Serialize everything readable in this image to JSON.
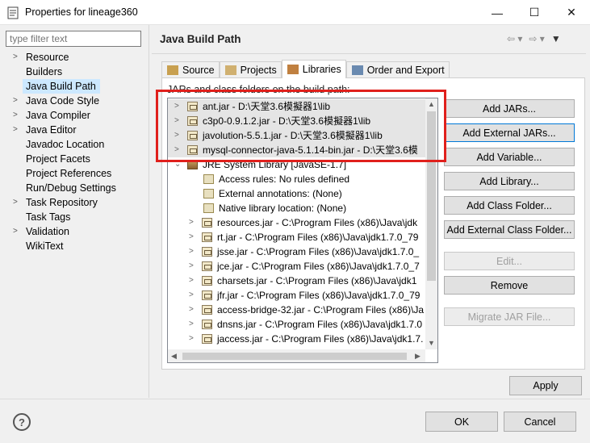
{
  "window": {
    "title": "Properties for lineage360",
    "minimize": "—",
    "maximize": "☐",
    "close": "✕"
  },
  "filter": {
    "placeholder": "type filter text"
  },
  "nav": [
    {
      "label": "Resource",
      "expandable": true
    },
    {
      "label": "Builders",
      "expandable": false
    },
    {
      "label": "Java Build Path",
      "expandable": false,
      "selected": true
    },
    {
      "label": "Java Code Style",
      "expandable": true
    },
    {
      "label": "Java Compiler",
      "expandable": true
    },
    {
      "label": "Java Editor",
      "expandable": true
    },
    {
      "label": "Javadoc Location",
      "expandable": false
    },
    {
      "label": "Project Facets",
      "expandable": false
    },
    {
      "label": "Project References",
      "expandable": false
    },
    {
      "label": "Run/Debug Settings",
      "expandable": false
    },
    {
      "label": "Task Repository",
      "expandable": true
    },
    {
      "label": "Task Tags",
      "expandable": false
    },
    {
      "label": "Validation",
      "expandable": true
    },
    {
      "label": "WikiText",
      "expandable": false
    }
  ],
  "page": {
    "title": "Java Build Path"
  },
  "tabs": [
    {
      "label": "Source",
      "icon": "source-folder-icon"
    },
    {
      "label": "Projects",
      "icon": "projects-icon"
    },
    {
      "label": "Libraries",
      "icon": "libraries-icon",
      "active": true
    },
    {
      "label": "Order and Export",
      "icon": "order-export-icon"
    }
  ],
  "libraries": {
    "label": "JARs and class folders on the build path:",
    "tree": [
      {
        "text": "ant.jar - D:\\天堂3.6模擬器1\\lib",
        "level": 0,
        "icon": "jar",
        "exp": ">",
        "hl": true
      },
      {
        "text": "c3p0-0.9.1.2.jar - D:\\天堂3.6模擬器1\\lib",
        "level": 0,
        "icon": "jar",
        "exp": ">",
        "hl": true
      },
      {
        "text": "javolution-5.5.1.jar - D:\\天堂3.6模擬器1\\lib",
        "level": 0,
        "icon": "jar",
        "exp": ">",
        "hl": true
      },
      {
        "text": "mysql-connector-java-5.1.14-bin.jar - D:\\天堂3.6模",
        "level": 0,
        "icon": "jar",
        "exp": ">",
        "hl": true
      },
      {
        "text": "JRE System Library [JavaSE-1.7]",
        "level": 0,
        "icon": "lib",
        "exp": "v",
        "hl": false
      },
      {
        "text": "Access rules: No rules defined",
        "level": 1,
        "icon": "rule",
        "exp": "",
        "hl": false
      },
      {
        "text": "External annotations: (None)",
        "level": 1,
        "icon": "rule",
        "exp": "",
        "hl": false
      },
      {
        "text": "Native library location: (None)",
        "level": 1,
        "icon": "rule",
        "exp": "",
        "hl": false
      },
      {
        "text": "resources.jar - C:\\Program Files (x86)\\Java\\jdk",
        "level": 1,
        "icon": "jar",
        "exp": ">",
        "hl": false
      },
      {
        "text": "rt.jar - C:\\Program Files (x86)\\Java\\jdk1.7.0_79",
        "level": 1,
        "icon": "jar",
        "exp": ">",
        "hl": false
      },
      {
        "text": "jsse.jar - C:\\Program Files (x86)\\Java\\jdk1.7.0_",
        "level": 1,
        "icon": "jar",
        "exp": ">",
        "hl": false
      },
      {
        "text": "jce.jar - C:\\Program Files (x86)\\Java\\jdk1.7.0_7",
        "level": 1,
        "icon": "jar",
        "exp": ">",
        "hl": false
      },
      {
        "text": "charsets.jar - C:\\Program Files (x86)\\Java\\jdk1",
        "level": 1,
        "icon": "jar",
        "exp": ">",
        "hl": false
      },
      {
        "text": "jfr.jar - C:\\Program Files (x86)\\Java\\jdk1.7.0_79",
        "level": 1,
        "icon": "jar",
        "exp": ">",
        "hl": false
      },
      {
        "text": "access-bridge-32.jar - C:\\Program Files (x86)\\Ja",
        "level": 1,
        "icon": "jar",
        "exp": ">",
        "hl": false
      },
      {
        "text": "dnsns.jar - C:\\Program Files (x86)\\Java\\jdk1.7.0",
        "level": 1,
        "icon": "jar",
        "exp": ">",
        "hl": false
      },
      {
        "text": "jaccess.jar - C:\\Program Files (x86)\\Java\\jdk1.7.",
        "level": 1,
        "icon": "jar",
        "exp": ">",
        "hl": false
      }
    ],
    "buttons": [
      {
        "label": "Add JARs...",
        "enabled": true
      },
      {
        "label": "Add External JARs...",
        "enabled": true,
        "focus": true
      },
      {
        "label": "Add Variable...",
        "enabled": true
      },
      {
        "label": "Add Library...",
        "enabled": true
      },
      {
        "label": "Add Class Folder...",
        "enabled": true
      },
      {
        "label": "Add External Class Folder...",
        "enabled": true
      },
      {
        "label": "Edit...",
        "enabled": false
      },
      {
        "label": "Remove",
        "enabled": true
      },
      {
        "label": "Migrate JAR File...",
        "enabled": false
      }
    ]
  },
  "footer": {
    "apply": "Apply",
    "help": "?",
    "ok": "OK",
    "cancel": "Cancel"
  },
  "colors": {
    "annotation_box": "#e0201c",
    "selection": "#cce8ff",
    "focus_border": "#0078d7"
  }
}
